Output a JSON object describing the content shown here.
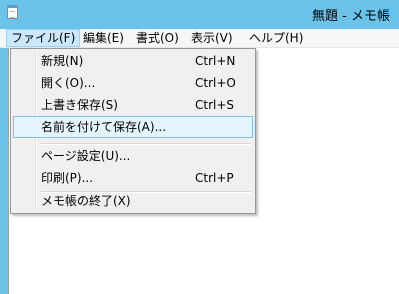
{
  "window": {
    "title": "無題 - メモ帳",
    "app_icon": "notepad-icon",
    "accent_color": "#6cc3e9"
  },
  "menubar": {
    "items": [
      {
        "label": "ファイル(F)",
        "active": true
      },
      {
        "label": "編集(E)"
      },
      {
        "label": "書式(O)"
      },
      {
        "label": "表示(V)"
      },
      {
        "label": "ヘルプ(H)"
      }
    ]
  },
  "file_menu": {
    "items": [
      {
        "label": "新規(N)",
        "shortcut": "Ctrl+N"
      },
      {
        "label": "開く(O)...",
        "shortcut": "Ctrl+O"
      },
      {
        "label": "上書き保存(S)",
        "shortcut": "Ctrl+S"
      },
      {
        "label": "名前を付けて保存(A)...",
        "highlighted": true
      },
      {
        "label": "ページ設定(U)..."
      },
      {
        "label": "印刷(P)...",
        "shortcut": "Ctrl+P"
      },
      {
        "label": "メモ帳の終了(X)"
      }
    ]
  }
}
